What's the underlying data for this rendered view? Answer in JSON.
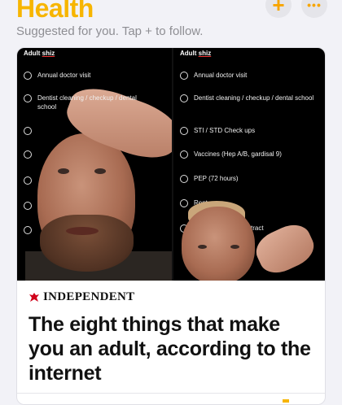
{
  "header": {
    "title": "Health",
    "subtitle": "Suggested for you. Tap + to follow.",
    "plus_label": "+",
    "more_label": "•••"
  },
  "card": {
    "list_title_prefix": "Adult ",
    "list_title_word": "shiz",
    "left_items": [
      "Annual doctor visit",
      "Dentist cleaning / checkup / dental school"
    ],
    "right_items": [
      "Annual doctor visit",
      "Dentist cleaning / checkup / dental school",
      "STI / STD Check ups",
      "Vaccines (Hep A/B, gardisal 9)",
      "PEP (72 hours)",
      "Rent",
      "tract"
    ],
    "publisher": "INDEPENDENT",
    "headline": "The eight things that make you an adult, according to the internet"
  },
  "colors": {
    "accent": "#f7b500",
    "background": "#f2f2f7"
  }
}
